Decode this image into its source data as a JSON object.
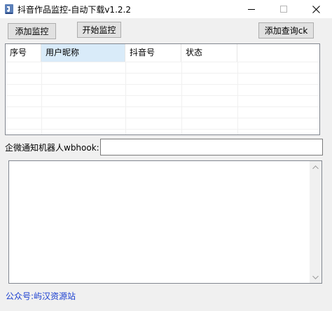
{
  "window": {
    "title": "抖音作品监控-自动下载v1.2.2"
  },
  "toolbar": {
    "add_monitor_label": "添加监控",
    "start_monitor_label": "开始监控",
    "add_query_ck_label": "添加查询ck"
  },
  "table": {
    "columns": [
      "序号",
      "用户昵称",
      "抖音号",
      "状态"
    ],
    "rows": []
  },
  "webhook": {
    "label": "企微通知机器人wbhook:",
    "value": ""
  },
  "log": {
    "text": ""
  },
  "footer": {
    "text": "公众号:屿汉资源站"
  },
  "colors": {
    "footer_link": "#1b3fd1",
    "selected_header": "#d9ebf9"
  }
}
